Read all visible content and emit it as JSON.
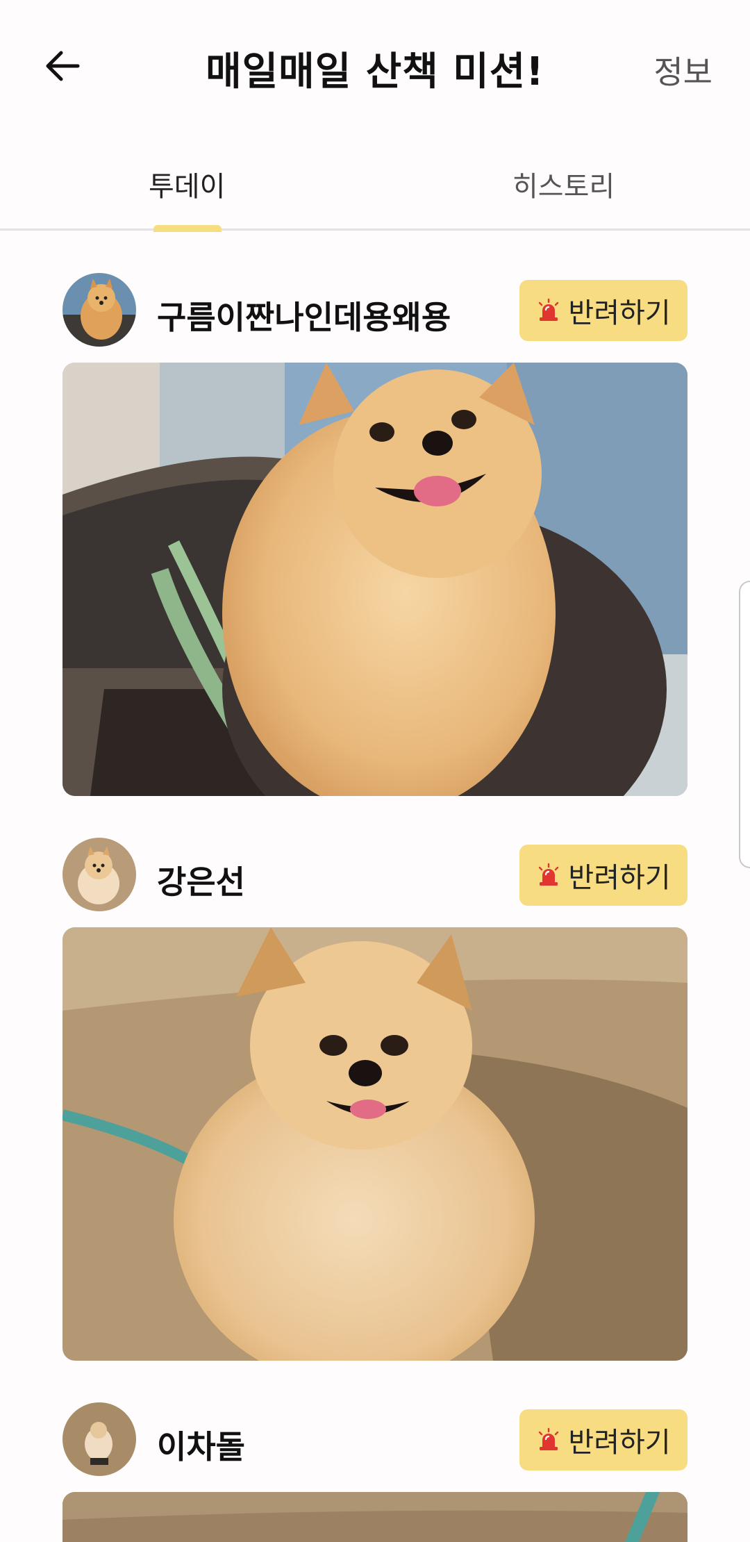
{
  "appbar": {
    "title": "매일매일 산책 미션!",
    "info_label": "정보",
    "back_icon": "arrow-left-icon"
  },
  "tabs": [
    {
      "label": "투데이",
      "selected": true
    },
    {
      "label": "히스토리",
      "selected": false
    }
  ],
  "colors": {
    "accent": "#f7dc82",
    "background": "#fffcfe",
    "siren": "#e0362f"
  },
  "posts": [
    {
      "username": "구름이짠나인데용왜용",
      "action_label": "반려하기",
      "action_icon": "siren-icon",
      "photo": "pomeranian-on-chair"
    },
    {
      "username": "강은선",
      "action_label": "반려하기",
      "action_icon": "siren-icon",
      "photo": "pomeranian-on-grass"
    },
    {
      "username": "이차돌",
      "action_label": "반려하기",
      "action_icon": "siren-icon",
      "photo": "dog-on-grass"
    }
  ]
}
